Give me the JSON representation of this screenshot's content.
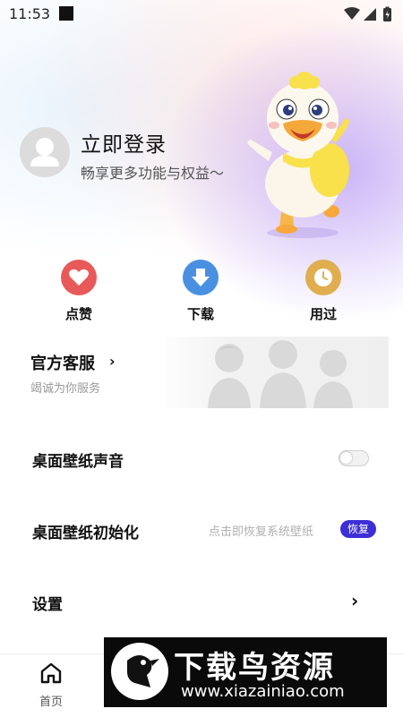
{
  "status_bar": {
    "time": "11:53"
  },
  "profile": {
    "title": "立即登录",
    "subtitle": "畅享更多功能与权益～"
  },
  "actions": [
    {
      "label": "点赞",
      "icon": "heart-icon",
      "color": "#e85a5a"
    },
    {
      "label": "下载",
      "icon": "download-icon",
      "color": "#4a90e2"
    },
    {
      "label": "用过",
      "icon": "clock-icon",
      "color": "#e0ad4f"
    }
  ],
  "service": {
    "title": "官方客服",
    "subtitle": "竭诚为你服务"
  },
  "settings": {
    "sound_label": "桌面壁纸声音",
    "sound_enabled": false,
    "init_label": "桌面壁纸初始化",
    "init_hint": "点击即恢复系统壁纸",
    "restore_label": "恢复",
    "settings_label": "设置"
  },
  "tabbar": {
    "home_label": "首页"
  },
  "watermark": {
    "title": "下载鸟资源",
    "url": "www.xiazainiao.com"
  },
  "colors": {
    "accent": "#3d2fd6"
  }
}
